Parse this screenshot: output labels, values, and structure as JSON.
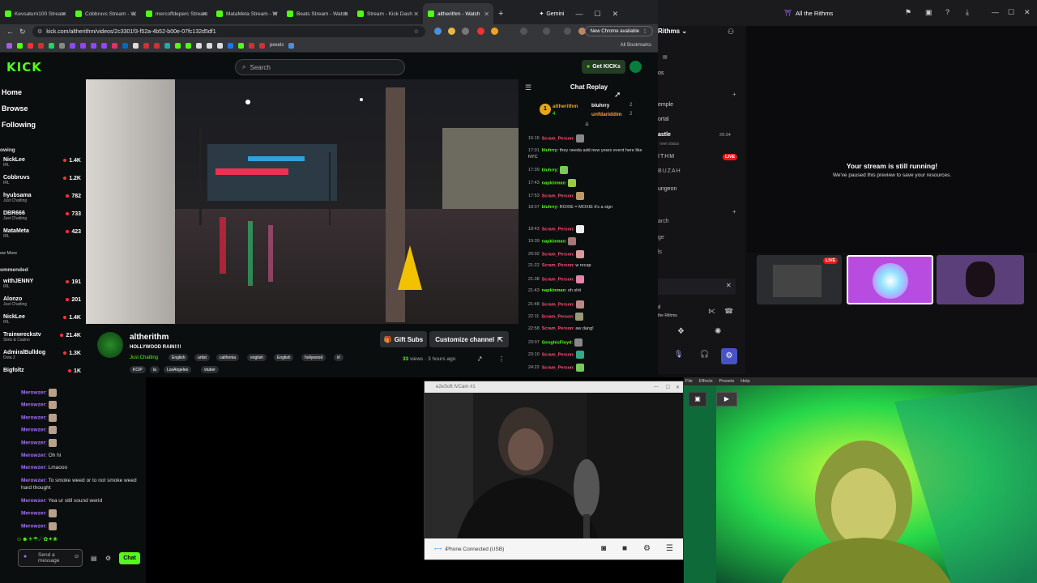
{
  "browser": {
    "tabs": [
      {
        "label": "Kevsaturn100 Stream"
      },
      {
        "label": "Cobbruvs Stream - W"
      },
      {
        "label": "mercoffdeperc Stream"
      },
      {
        "label": "MataMeta Stream - W"
      },
      {
        "label": "Beats Stream - Watch"
      },
      {
        "label": "Stream - Kick Dash"
      },
      {
        "label": "altherithm - Watch"
      }
    ],
    "new_tab": "+",
    "gemini": "Gemini",
    "url": "kick.com/altherithm/videos/2c3301f3-f52a-4b52-b00e-07fc132d5df1",
    "new_chrome": "New Chrome available",
    "all_bookmarks": "All Bookmarks",
    "bookmark_pexels": "pexels"
  },
  "kick": {
    "logo": "KICK",
    "search_placeholder": "Search",
    "get_kicks": "Get KICKs",
    "nav": {
      "home": "Home",
      "browse": "Browse",
      "following": "Following"
    },
    "following_title": "owing",
    "following": [
      {
        "name": "NickLee",
        "cat": "IRL",
        "viewers": "1.4K"
      },
      {
        "name": "Cobbruvs",
        "cat": "IRL",
        "viewers": "1.2K"
      },
      {
        "name": "hyubsama",
        "cat": "Just Chatting",
        "viewers": "782"
      },
      {
        "name": "DBR666",
        "cat": "Just Chatting",
        "viewers": "733"
      },
      {
        "name": "MataMeta",
        "cat": "IRL",
        "viewers": "423"
      }
    ],
    "show_more": "ow More",
    "recommended_title": "ommended",
    "recommended": [
      {
        "name": "withJENNY",
        "cat": "IRL",
        "viewers": "191"
      },
      {
        "name": "Alonzo",
        "cat": "Just Chatting",
        "viewers": "201"
      },
      {
        "name": "NickLee",
        "cat": "IRL",
        "viewers": "1.4K"
      },
      {
        "name": "Trainwreckstv",
        "cat": "Slots & Casino",
        "viewers": "21.4K"
      },
      {
        "name": "AdmiralBulldog",
        "cat": "Dota 2",
        "viewers": "1.3K"
      },
      {
        "name": "Bigfoltz",
        "cat": "",
        "viewers": "1K"
      }
    ],
    "channel": {
      "name": "altherithm",
      "title": "HOLLYWOOD RAIN!!!!",
      "category": "Just Chatting",
      "tags": [
        "English",
        "artist",
        "california",
        "english",
        "English",
        "hollywood",
        "irl"
      ],
      "tags2": [
        "KCIP",
        "la",
        "LosAngeles",
        "vtuber"
      ],
      "views_count": "33",
      "views_suffix": " views · 3 hours ago",
      "gift_subs": "Gift Subs",
      "customize": "Customize channel"
    },
    "chat": {
      "title": "Chat Replay",
      "leaders": [
        {
          "rank": "1",
          "name": "altherithm",
          "count": "4"
        },
        {
          "name": "bluhrry",
          "count": "2"
        },
        {
          "name": "unfdariddim",
          "count": "2"
        }
      ],
      "messages": [
        {
          "time": "16:15",
          "user": "Scram_Person",
          "color": "#ff4f6d",
          "text": ":"
        },
        {
          "time": "17:01",
          "user": "bluhrry",
          "color": "#53fc18",
          "text": ": they needa add new years event here like NYC"
        },
        {
          "time": "17:39",
          "user": "bluhrry",
          "color": "#53fc18",
          "text": ":"
        },
        {
          "time": "17:43",
          "user": "napkinman",
          "color": "#53fc18",
          "text": ":"
        },
        {
          "time": "17:53",
          "user": "Scram_Person",
          "color": "#ff4f6d",
          "text": ":"
        },
        {
          "time": "18:07",
          "user": "bluhrry",
          "color": "#53fc18",
          "text": ": ROXIE = MOXIE it's a sign"
        },
        {
          "time": "18:43",
          "user": "Scram_Person",
          "color": "#ff4f6d",
          "text": ":"
        },
        {
          "time": "19:39",
          "user": "napkinman",
          "color": "#53fc18",
          "text": ":"
        },
        {
          "time": "20:02",
          "user": "Scram_Person",
          "color": "#ff4f6d",
          "text": ":"
        },
        {
          "time": "21:22",
          "user": "Scram_Person",
          "color": "#ff4f6d",
          "text": ": w recap"
        },
        {
          "time": "21:38",
          "user": "Scram_Person",
          "color": "#ff4f6d",
          "text": ":"
        },
        {
          "time": "21:43",
          "user": "napkinman",
          "color": "#53fc18",
          "text": ": oh shit"
        },
        {
          "time": "21:48",
          "user": "Scram_Person",
          "color": "#ff4f6d",
          "text": ":"
        },
        {
          "time": "22:11",
          "user": "Scram_Person",
          "color": "#ff4f6d",
          "text": ":"
        },
        {
          "time": "22:58",
          "user": "Scram_Person",
          "color": "#ff4f6d",
          "text": ": aw dang!"
        },
        {
          "time": "23:07",
          "user": "GenghisFloyd",
          "color": "#53fc18",
          "text": ":"
        },
        {
          "time": "23:10",
          "user": "Scram_Person",
          "color": "#ff4f6d",
          "text": ":"
        },
        {
          "time": "24:22",
          "user": "Scram_Person",
          "color": "#ff4f6d",
          "text": ":"
        }
      ]
    }
  },
  "right_app": {
    "title": "All the Rithms",
    "side_title": "Rithms",
    "side_items": [
      "os",
      "emple",
      "ortal",
      "astle",
      "nnel status",
      "ITHM",
      "BUZAH",
      "ungeon",
      "arch",
      "ge",
      "ls",
      "d",
      "the Rithms"
    ],
    "time": "29:34",
    "live": "LIVE",
    "msg_title": "Your stream is still running!",
    "msg_sub": "We've paused this preview to save your resources.",
    "thumb_live": "LIVE"
  },
  "bottom_chat": {
    "messages": [
      {
        "user": "Merowzer",
        "text": ":"
      },
      {
        "user": "Merowzer",
        "text": ":"
      },
      {
        "user": "Merowzer",
        "text": ":"
      },
      {
        "user": "Merowzer",
        "text": ":"
      },
      {
        "user": "Merowzer",
        "text": ":"
      },
      {
        "user": "Merowzer",
        "text": ": Oh hi"
      },
      {
        "user": "Merowzer",
        "text": ": Lmaooo"
      },
      {
        "user": "Merowzer",
        "text": ": To smoke weed or to not smoke weed hard thought"
      },
      {
        "user": "Merowzer",
        "text": ": Yea ur still sound werid"
      },
      {
        "user": "Merowzer",
        "text": ":"
      },
      {
        "user": "Merowzer",
        "text": ":"
      }
    ],
    "send_placeholder": "Send a message",
    "chat_button": "Chat"
  },
  "webcam_app": {
    "title": "e2eSoft iVCam #1",
    "status": "iPhone Connected (USB)"
  },
  "obs": {
    "menu": [
      "File",
      "Effects",
      "Presets",
      "Help"
    ]
  },
  "colors": {
    "kick_green": "#53fc18",
    "live_red": "#e91916",
    "user_purple": "#a970ff"
  }
}
